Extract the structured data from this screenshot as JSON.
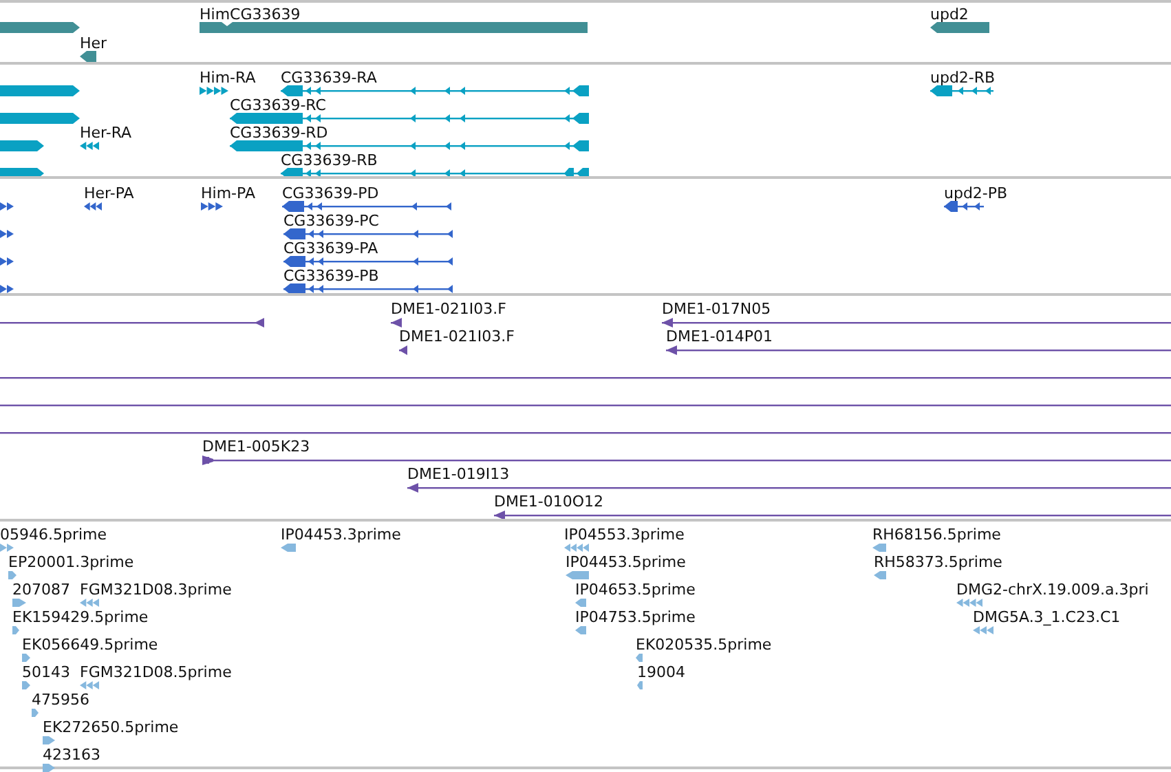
{
  "tracks": [
    {
      "features": [
        {
          "kind": "gene"
        },
        {
          "kind": "gene",
          "label": "HimCG33639"
        },
        {
          "kind": "gene",
          "label": "Her"
        },
        {
          "kind": "gene",
          "label": "upd2"
        }
      ]
    },
    {
      "features": [
        {
          "kind": "transcript"
        },
        {
          "kind": "transcript"
        },
        {
          "kind": "transcript"
        },
        {
          "kind": "transcript"
        },
        {
          "kind": "transcript",
          "label": "Him-RA"
        },
        {
          "kind": "transcript",
          "label": "CG33639-RA"
        },
        {
          "kind": "transcript",
          "label": "upd2-RB"
        },
        {
          "kind": "transcript",
          "label": "CG33639-RC"
        },
        {
          "kind": "transcript",
          "label": "Her-RA"
        },
        {
          "kind": "transcript",
          "label": "CG33639-RD"
        },
        {
          "kind": "transcript",
          "label": "CG33639-RB"
        }
      ]
    },
    {
      "features": [
        {
          "kind": "protein"
        },
        {
          "kind": "protein"
        },
        {
          "kind": "protein"
        },
        {
          "kind": "protein"
        },
        {
          "kind": "protein",
          "label": "Her-PA"
        },
        {
          "kind": "protein",
          "label": "Him-PA"
        },
        {
          "kind": "protein",
          "label": "CG33639-PD"
        },
        {
          "kind": "protein",
          "label": "upd2-PB"
        },
        {
          "kind": "protein",
          "label": "CG33639-PC"
        },
        {
          "kind": "protein",
          "label": "CG33639-PA"
        },
        {
          "kind": "protein",
          "label": "CG33639-PB"
        }
      ]
    },
    {
      "features": [
        {
          "kind": "clone"
        },
        {
          "kind": "clone",
          "label": "DME1-021I03.F"
        },
        {
          "kind": "clone",
          "label": "DME1-017N05"
        },
        {
          "kind": "clone",
          "label": "DME1-021I03.F"
        },
        {
          "kind": "clone",
          "label": "DME1-014P01"
        },
        {
          "kind": "clone"
        },
        {
          "kind": "clone"
        },
        {
          "kind": "clone"
        },
        {
          "kind": "clone",
          "label": "DME1-005K23"
        },
        {
          "kind": "clone",
          "label": "DME1-019I13"
        },
        {
          "kind": "clone",
          "label": "DME1-010O12"
        }
      ]
    },
    {
      "features": [
        {
          "kind": "est",
          "label": "05946.5prime"
        },
        {
          "kind": "est",
          "label": "IP04453.3prime"
        },
        {
          "kind": "est",
          "label": "IP04553.3prime"
        },
        {
          "kind": "est",
          "label": "RH68156.5prime"
        },
        {
          "kind": "est",
          "label": "EP20001.3prime"
        },
        {
          "kind": "est",
          "label": "IP04453.5prime"
        },
        {
          "kind": "est",
          "label": "RH58373.5prime"
        },
        {
          "kind": "est",
          "label": "207087"
        },
        {
          "kind": "est",
          "label": "FGM321D08.3prime"
        },
        {
          "kind": "est",
          "label": "IP04653.5prime"
        },
        {
          "kind": "est",
          "label": "DMG2-chrX.19.009.a.3pri"
        },
        {
          "kind": "est",
          "label": "EK159429.5prime"
        },
        {
          "kind": "est",
          "label": "IP04753.5prime"
        },
        {
          "kind": "est",
          "label": "DMG5A.3_1.C23.C1"
        },
        {
          "kind": "est",
          "label": "EK056649.5prime"
        },
        {
          "kind": "est",
          "label": "EK020535.5prime"
        },
        {
          "kind": "est",
          "label": "50143"
        },
        {
          "kind": "est",
          "label": "FGM321D08.5prime"
        },
        {
          "kind": "est",
          "label": "19004"
        },
        {
          "kind": "est",
          "label": "475956"
        },
        {
          "kind": "est",
          "label": "EK272650.5prime"
        },
        {
          "kind": "est",
          "label": "423163"
        }
      ]
    }
  ]
}
